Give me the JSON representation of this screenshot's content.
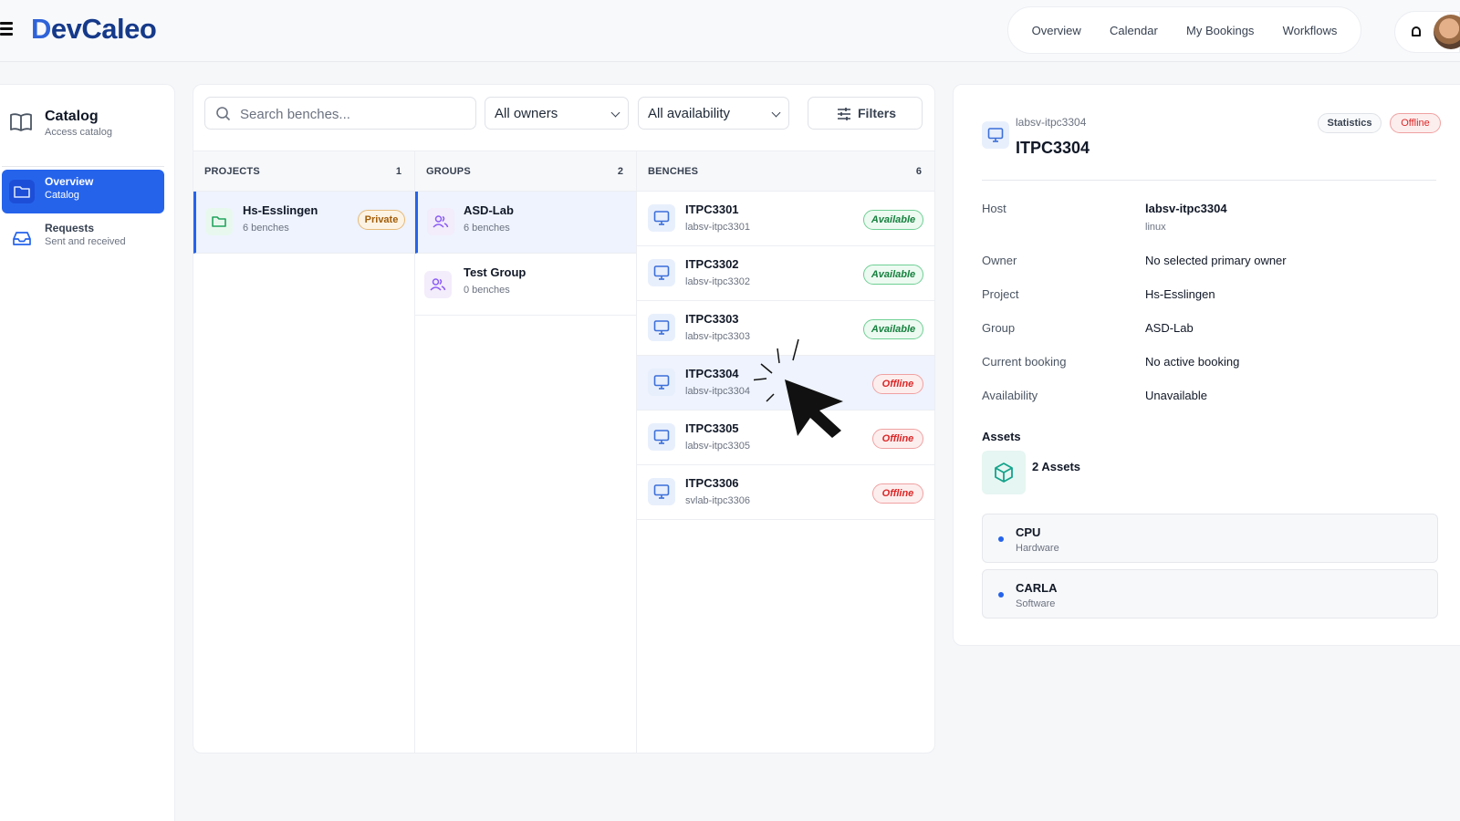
{
  "header": {
    "logo": "DevCaleo",
    "nav": [
      "Overview",
      "Calendar",
      "My Bookings",
      "Workflows"
    ]
  },
  "sidebar": {
    "title": "Catalog",
    "subtitle": "Access catalog",
    "items": [
      {
        "label": "Overview",
        "sub": "Catalog",
        "active": true
      },
      {
        "label": "Requests",
        "sub": "Sent and received",
        "active": false
      }
    ]
  },
  "toolbar": {
    "search_placeholder": "Search benches...",
    "owner_select": "All owners",
    "availability_select": "All availability",
    "filters_label": "Filters"
  },
  "projects": {
    "header": "PROJECTS",
    "count": "1",
    "items": [
      {
        "name": "Hs-Esslingen",
        "sub": "6 benches",
        "badge": "Private"
      }
    ]
  },
  "groups": {
    "header": "GROUPS",
    "count": "2",
    "items": [
      {
        "name": "ASD-Lab",
        "sub": "6 benches"
      },
      {
        "name": "Test Group",
        "sub": "0 benches"
      }
    ]
  },
  "benches": {
    "header": "BENCHES",
    "count": "6",
    "items": [
      {
        "name": "ITPC3301",
        "host": "labsv-itpc3301",
        "status": "Available"
      },
      {
        "name": "ITPC3302",
        "host": "labsv-itpc3302",
        "status": "Available"
      },
      {
        "name": "ITPC3303",
        "host": "labsv-itpc3303",
        "status": "Available"
      },
      {
        "name": "ITPC3304",
        "host": "labsv-itpc3304",
        "status": "Offline"
      },
      {
        "name": "ITPC3305",
        "host": "labsv-itpc3305",
        "status": "Offline"
      },
      {
        "name": "ITPC3306",
        "host": "svlab-itpc3306",
        "status": "Offline"
      }
    ]
  },
  "detail": {
    "host_small": "labsv-itpc3304",
    "title": "ITPC3304",
    "statistics_label": "Statistics",
    "status": "Offline",
    "fields": {
      "host_label": "Host",
      "host_value": "labsv-itpc3304",
      "host_os": "linux",
      "owner_label": "Owner",
      "owner_value": "No selected primary owner",
      "project_label": "Project",
      "project_value": "Hs-Esslingen",
      "group_label": "Group",
      "group_value": "ASD-Lab",
      "booking_label": "Current booking",
      "booking_value": "No active booking",
      "availability_label": "Availability",
      "availability_value": "Unavailable"
    },
    "assets_title": "Assets",
    "assets_count": "2 Assets",
    "assets": [
      {
        "name": "CPU",
        "type": "Hardware"
      },
      {
        "name": "CARLA",
        "type": "Software"
      }
    ]
  },
  "colors": {
    "accent": "#2563eb",
    "available": "#15803d",
    "offline": "#dc2626",
    "private": "#a15c07"
  }
}
